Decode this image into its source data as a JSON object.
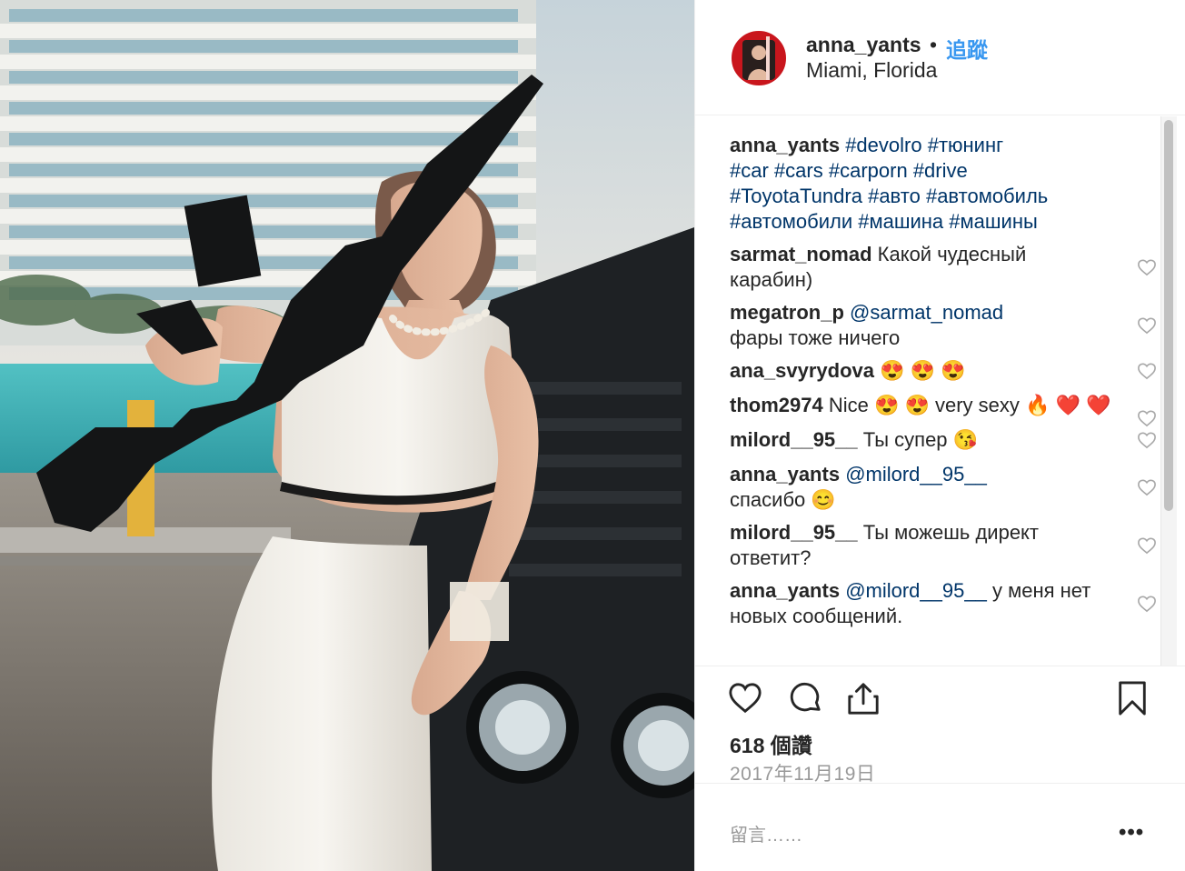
{
  "post": {
    "username": "anna_yants",
    "separator": "•",
    "follow_label": "追蹤",
    "location": "Miami, Florida",
    "caption": {
      "user": "anna_yants",
      "tags": [
        "#devolro",
        "#тюнинг",
        "#car",
        "#cars",
        "#carporn",
        "#drive",
        "#ToyotaTundra",
        "#авто",
        "#автомобиль",
        "#автомобили",
        "#машина",
        "#машины"
      ]
    },
    "comments": [
      {
        "user": "sarmat_nomad",
        "mention": "",
        "text": "Какой чудесный карабин)"
      },
      {
        "user": "megatron_p",
        "mention": "@sarmat_nomad",
        "text": "фары тоже ничего"
      },
      {
        "user": "ana_svyrydova",
        "mention": "",
        "text": "😍 😍 😍"
      },
      {
        "user": "thom2974",
        "mention": "",
        "text": "Nice 😍 😍 very sexy 🔥 ❤️ ❤️"
      },
      {
        "user": "milord__95__",
        "mention": "",
        "text": "Ты супер 😘"
      },
      {
        "user": "anna_yants",
        "mention": "@milord__95__",
        "text": "спасибо 😊"
      },
      {
        "user": "milord__95__",
        "mention": "",
        "text": "Ты можешь директ ответит?"
      },
      {
        "user": "anna_yants",
        "mention": "@milord__95__",
        "text": "у меня нет новых сообщений."
      }
    ],
    "likes": "618 個讚",
    "date": "2017年11月19日",
    "comment_placeholder": "留言……",
    "more_label": "•••",
    "icons": {
      "like": "heart-outline-icon",
      "comment": "speech-bubble-icon",
      "share": "share-upload-icon",
      "save": "bookmark-icon",
      "comment_like": "small-heart-icon"
    }
  }
}
